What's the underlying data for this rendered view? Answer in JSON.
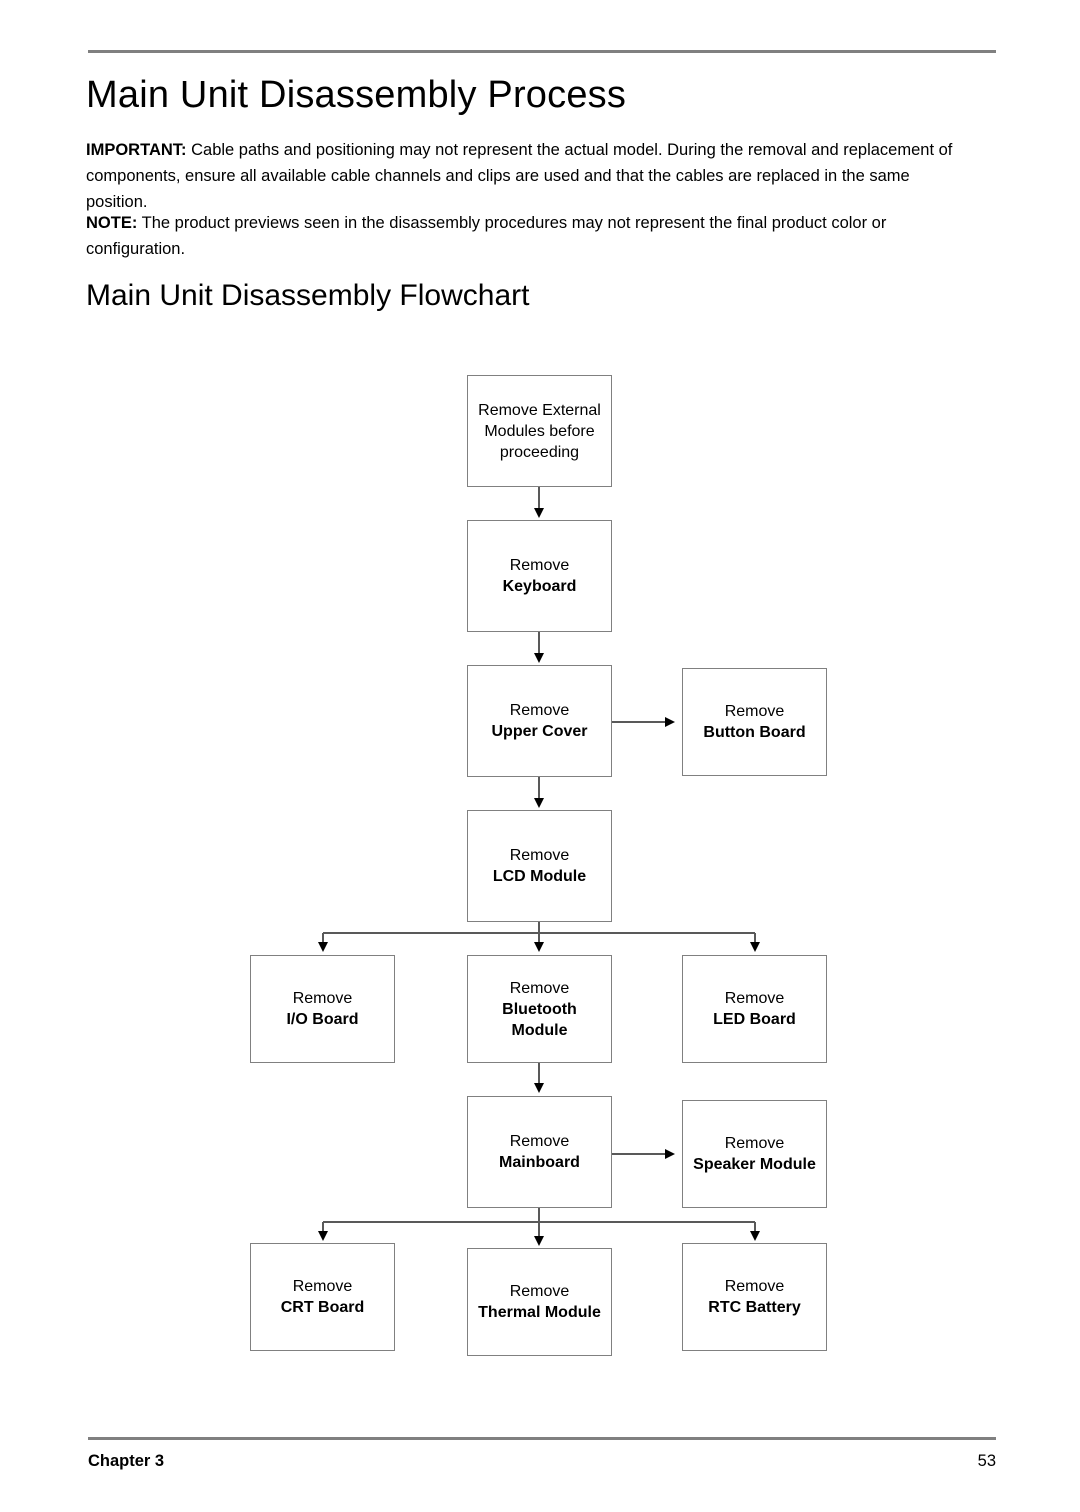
{
  "document": {
    "title": "Main Unit Disassembly Process",
    "important_label": "IMPORTANT:",
    "important_text": " Cable paths and positioning may not represent the actual model. During the removal and replacement of components, ensure all available cable channels and clips are used and that the cables are replaced in the same position.",
    "note_label": "NOTE:",
    "note_text": " The product previews seen in the disassembly procedures may not represent the final product color or configuration.",
    "section_title": "Main Unit Disassembly Flowchart"
  },
  "footer": {
    "chapter": "Chapter 3",
    "page_number": "53"
  },
  "flowchart": {
    "nodes": {
      "external_modules": {
        "line1": "Remove External",
        "line2": "Modules before",
        "line3": "proceeding"
      },
      "keyboard": {
        "line1": "Remove",
        "line2": "Keyboard"
      },
      "upper_cover": {
        "line1": "Remove",
        "line2": "Upper Cover"
      },
      "button_board": {
        "line1": "Remove",
        "line2": "Button Board"
      },
      "lcd_module": {
        "line1": "Remove",
        "line2": "LCD Module"
      },
      "io_board": {
        "line1": "Remove",
        "line2": "I/O Board"
      },
      "bluetooth_module": {
        "line1": "Remove",
        "line2": "Bluetooth Module"
      },
      "led_board": {
        "line1": "Remove",
        "line2": "LED Board"
      },
      "mainboard": {
        "line1": "Remove",
        "line2": "Mainboard"
      },
      "speaker_module": {
        "line1": "Remove",
        "line2": "Speaker Module"
      },
      "crt_board": {
        "line1": "Remove",
        "line2": "CRT Board"
      },
      "thermal_module": {
        "line1": "Remove",
        "line2": "Thermal Module"
      },
      "rtc_battery": {
        "line1": "Remove",
        "line2": "RTC Battery"
      }
    },
    "colors": {
      "box_border": "#808080",
      "connector": "#595959",
      "rule": "#808080",
      "text": "#000000"
    }
  }
}
